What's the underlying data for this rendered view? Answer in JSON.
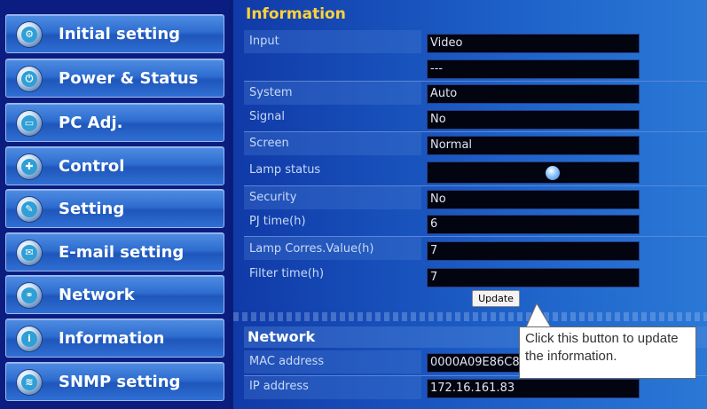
{
  "sidebar": {
    "items": [
      {
        "label": "Initial setting",
        "icon": "initial-setting-icon",
        "glyph": "⚙"
      },
      {
        "label": "Power & Status",
        "icon": "power-status-icon",
        "glyph": "⏻"
      },
      {
        "label": "PC Adj.",
        "icon": "pc-adjust-icon",
        "glyph": "▭"
      },
      {
        "label": "Control",
        "icon": "control-icon",
        "glyph": "✚"
      },
      {
        "label": "Setting",
        "icon": "setting-icon",
        "glyph": "✎"
      },
      {
        "label": "E-mail setting",
        "icon": "email-icon",
        "glyph": "✉"
      },
      {
        "label": "Network",
        "icon": "network-icon",
        "glyph": "⚭"
      },
      {
        "label": "Information",
        "icon": "information-icon",
        "glyph": "i"
      },
      {
        "label": "SNMP setting",
        "icon": "snmp-icon",
        "glyph": "≋"
      }
    ]
  },
  "information": {
    "title": "Information",
    "rows": [
      {
        "label": "Input",
        "value": "Video"
      },
      {
        "label": "",
        "value": "---"
      },
      {
        "label": "System",
        "value": "Auto"
      },
      {
        "label": "Signal",
        "value": "No"
      },
      {
        "label": "Screen",
        "value": "Normal"
      },
      {
        "label": "Lamp status",
        "value": ""
      },
      {
        "label": "Security",
        "value": "No"
      },
      {
        "label": "PJ time(h)",
        "value": "6"
      },
      {
        "label": "Lamp Corres.Value(h)",
        "value": "7"
      },
      {
        "label": "Filter time(h)",
        "value": "7"
      }
    ],
    "update_label": "Update"
  },
  "network": {
    "title": "Network",
    "rows": [
      {
        "label": "MAC address",
        "value": "0000A09E86C8"
      },
      {
        "label": "IP address",
        "value": "172.16.161.83"
      }
    ]
  },
  "callout": {
    "text": "Click this button to update the information."
  },
  "colors": {
    "section_title": "#ffd23a",
    "value_bg": "#020410",
    "nav_button": "#2e6dd0",
    "lamp_indicator": "#5fa8ff"
  }
}
